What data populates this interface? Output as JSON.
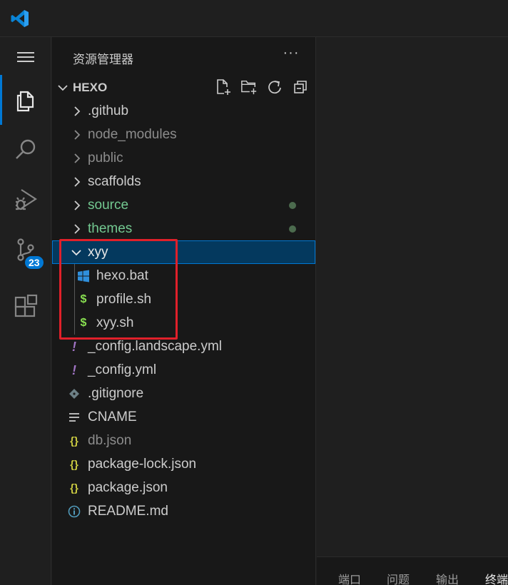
{
  "sidebar": {
    "title": "资源管理器",
    "more_label": "···",
    "section": {
      "title": "HEXO"
    }
  },
  "activity": {
    "scm_badge": "23"
  },
  "tree": [
    {
      "label": ".github",
      "kind": "folder",
      "color": "#cccccc"
    },
    {
      "label": "node_modules",
      "kind": "folder",
      "color": "#8c8c8c"
    },
    {
      "label": "public",
      "kind": "folder",
      "color": "#8c8c8c"
    },
    {
      "label": "scaffolds",
      "kind": "folder",
      "color": "#cccccc"
    },
    {
      "label": "source",
      "kind": "folder",
      "color": "#73c991"
    },
    {
      "label": "themes",
      "kind": "folder",
      "color": "#73c991"
    },
    {
      "label": "xyy",
      "kind": "folder-open",
      "color": "#e7e7e7"
    },
    {
      "label": "hexo.bat",
      "kind": "windows-icon",
      "color": "#cccccc"
    },
    {
      "label": "profile.sh",
      "kind": "shell-icon",
      "color": "#cccccc"
    },
    {
      "label": "xyy.sh",
      "kind": "shell-icon",
      "color": "#cccccc"
    },
    {
      "label": "_config.landscape.yml",
      "kind": "yaml-icon",
      "color": "#cccccc"
    },
    {
      "label": "_config.yml",
      "kind": "yaml-icon",
      "color": "#cccccc"
    },
    {
      "label": ".gitignore",
      "kind": "git-icon",
      "color": "#cccccc"
    },
    {
      "label": "CNAME",
      "kind": "text-icon",
      "color": "#cccccc"
    },
    {
      "label": "db.json",
      "kind": "json-icon",
      "color": "#8c8c8c"
    },
    {
      "label": "package-lock.json",
      "kind": "json-icon",
      "color": "#cccccc"
    },
    {
      "label": "package.json",
      "kind": "json-icon",
      "color": "#cccccc"
    },
    {
      "label": "README.md",
      "kind": "info-icon",
      "color": "#cccccc"
    }
  ],
  "panel": {
    "tabs": [
      "端口",
      "问题",
      "输出",
      "终端"
    ]
  },
  "colors": {
    "accent": "#0078d4",
    "modified_green": "#73c991",
    "highlight_red": "#e0202a",
    "json_yellow": "#cbcb41",
    "shell_green": "#89e051",
    "yaml_purple": "#a074c4"
  }
}
